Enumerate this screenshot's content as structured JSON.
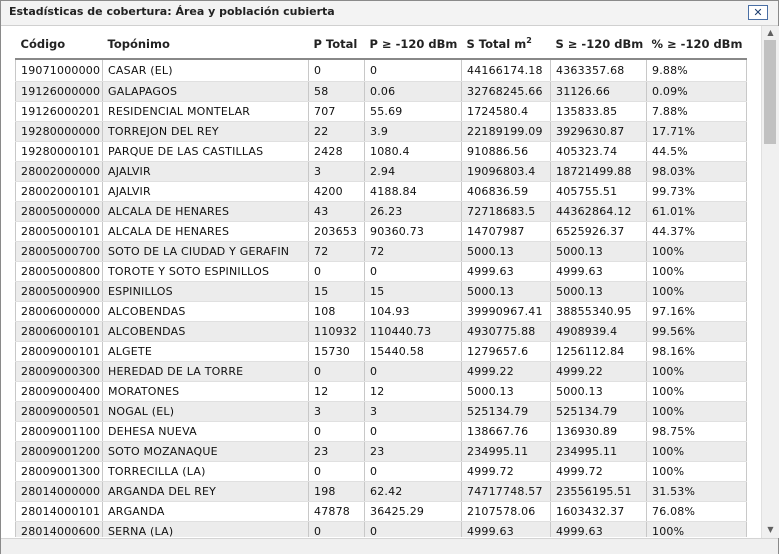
{
  "window": {
    "title": "Estadísticas de cobertura: Área y población cubierta",
    "close_label": "✕"
  },
  "table": {
    "headers": {
      "codigo": "Código",
      "toponimo": "Topónimo",
      "p_total": "P Total",
      "p_ge": "P ≥ -120 dBm",
      "s_total": "S Total m",
      "s_total_sup": "2",
      "s_ge": "S ≥ -120 dBm",
      "pct_ge": "% ≥ -120 dBm"
    },
    "rows": [
      [
        "19071000000",
        "CASAR (EL)",
        "0",
        "0",
        "44166174.18",
        "4363357.68",
        "9.88%"
      ],
      [
        "19126000000",
        "GALAPAGOS",
        "58",
        "0.06",
        "32768245.66",
        "31126.66",
        "0.09%"
      ],
      [
        "19126000201",
        "RESIDENCIAL MONTELAR",
        "707",
        "55.69",
        "1724580.4",
        "135833.85",
        "7.88%"
      ],
      [
        "19280000000",
        "TORREJON DEL REY",
        "22",
        "3.9",
        "22189199.09",
        "3929630.87",
        "17.71%"
      ],
      [
        "19280000101",
        "PARQUE DE LAS CASTILLAS",
        "2428",
        "1080.4",
        "910886.56",
        "405323.74",
        "44.5%"
      ],
      [
        "28002000000",
        "AJALVIR",
        "3",
        "2.94",
        "19096803.4",
        "18721499.88",
        "98.03%"
      ],
      [
        "28002000101",
        "AJALVIR",
        "4200",
        "4188.84",
        "406836.59",
        "405755.51",
        "99.73%"
      ],
      [
        "28005000000",
        "ALCALA DE HENARES",
        "43",
        "26.23",
        "72718683.5",
        "44362864.12",
        "61.01%"
      ],
      [
        "28005000101",
        "ALCALA DE HENARES",
        "203653",
        "90360.73",
        "14707987",
        "6525926.37",
        "44.37%"
      ],
      [
        "28005000700",
        "SOTO DE LA CIUDAD Y GERAFIN",
        "72",
        "72",
        "5000.13",
        "5000.13",
        "100%"
      ],
      [
        "28005000800",
        "TOROTE Y SOTO ESPINILLOS",
        "0",
        "0",
        "4999.63",
        "4999.63",
        "100%"
      ],
      [
        "28005000900",
        "ESPINILLOS",
        "15",
        "15",
        "5000.13",
        "5000.13",
        "100%"
      ],
      [
        "28006000000",
        "ALCOBENDAS",
        "108",
        "104.93",
        "39990967.41",
        "38855340.95",
        "97.16%"
      ],
      [
        "28006000101",
        "ALCOBENDAS",
        "110932",
        "110440.73",
        "4930775.88",
        "4908939.4",
        "99.56%"
      ],
      [
        "28009000101",
        "ALGETE",
        "15730",
        "15440.58",
        "1279657.6",
        "1256112.84",
        "98.16%"
      ],
      [
        "28009000300",
        "HEREDAD DE LA TORRE",
        "0",
        "0",
        "4999.22",
        "4999.22",
        "100%"
      ],
      [
        "28009000400",
        "MORATONES",
        "12",
        "12",
        "5000.13",
        "5000.13",
        "100%"
      ],
      [
        "28009000501",
        "NOGAL (EL)",
        "3",
        "3",
        "525134.79",
        "525134.79",
        "100%"
      ],
      [
        "28009001100",
        "DEHESA NUEVA",
        "0",
        "0",
        "138667.76",
        "136930.89",
        "98.75%"
      ],
      [
        "28009001200",
        "SOTO MOZANAQUE",
        "23",
        "23",
        "234995.11",
        "234995.11",
        "100%"
      ],
      [
        "28009001300",
        "TORRECILLA (LA)",
        "0",
        "0",
        "4999.72",
        "4999.72",
        "100%"
      ],
      [
        "28014000000",
        "ARGANDA DEL REY",
        "198",
        "62.42",
        "74717748.57",
        "23556195.51",
        "31.53%"
      ],
      [
        "28014000101",
        "ARGANDA",
        "47878",
        "36425.29",
        "2107578.06",
        "1603432.37",
        "76.08%"
      ],
      [
        "28014000600",
        "SERNA (LA)",
        "0",
        "0",
        "4999.63",
        "4999.63",
        "100%"
      ]
    ]
  },
  "scrollbar": {
    "up_arrow": "▲",
    "down_arrow": "▼"
  }
}
